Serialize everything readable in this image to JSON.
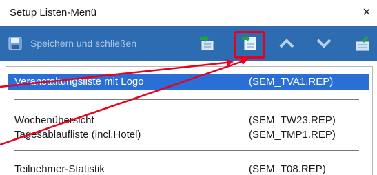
{
  "window": {
    "title": "Setup Listen-Menü",
    "close_glyph": "×"
  },
  "toolbar": {
    "save_label": "Speichern und schließen",
    "buttons": [
      {
        "name": "insert-above-icon"
      },
      {
        "name": "insert-below-icon"
      },
      {
        "name": "move-up-icon"
      },
      {
        "name": "move-down-icon"
      },
      {
        "name": "edit-icon"
      }
    ]
  },
  "list": {
    "rows": [
      {
        "name": "Veranstaltungsliste mit Logo",
        "file": "(SEM_TVA1.REP)",
        "selected": true
      },
      {
        "name": "Wochenübersicht",
        "file": "(SEM_TW23.REP)",
        "selected": false
      },
      {
        "name": "Tagesablaufliste (incl.Hotel)",
        "file": "(SEM_TMP1.REP)",
        "selected": false
      },
      {
        "name": "Teilnehmer-Statistik",
        "file": "(SEM_T08.REP)",
        "selected": false
      }
    ]
  },
  "colors": {
    "toolbar_bg": "#2e6cb2",
    "selection_bg": "#2a6fd6",
    "annotation_red": "#e8001c"
  }
}
